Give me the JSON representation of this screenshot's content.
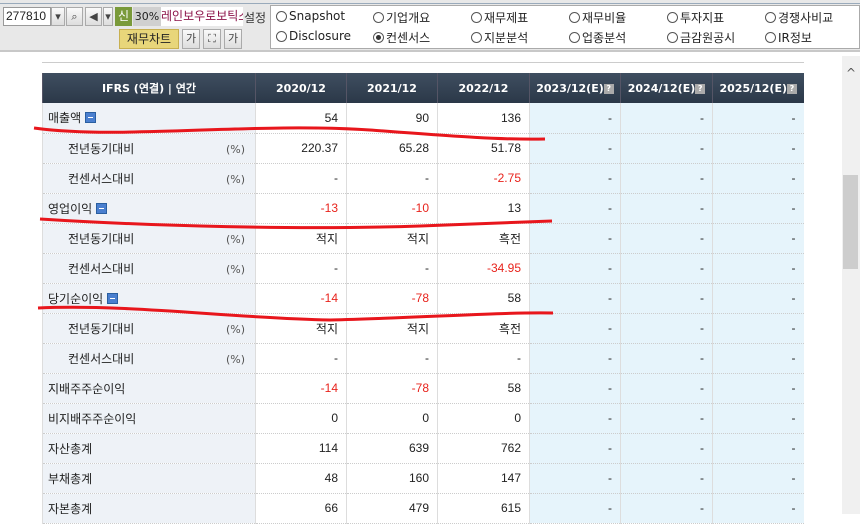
{
  "toolbar": {
    "stock_code": "277810",
    "badge": "신",
    "percent": "30%",
    "company": "레인보우로보틱스",
    "settings_label": "설정",
    "chart_button": "재무차트",
    "font_down": "가",
    "font_up": "가"
  },
  "radios": [
    {
      "label": "Snapshot",
      "checked": false
    },
    {
      "label": "기업개요",
      "checked": false
    },
    {
      "label": "재무제표",
      "checked": false
    },
    {
      "label": "재무비율",
      "checked": false
    },
    {
      "label": "투자지표",
      "checked": false
    },
    {
      "label": "경쟁사비교",
      "checked": false
    },
    {
      "label": "Disclosure",
      "checked": false
    },
    {
      "label": "컨센서스",
      "checked": true
    },
    {
      "label": "지분분석",
      "checked": false
    },
    {
      "label": "업종분석",
      "checked": false
    },
    {
      "label": "금감원공시",
      "checked": false
    },
    {
      "label": "IR정보",
      "checked": false
    }
  ],
  "table": {
    "header": "IFRS (연결) | 연간",
    "columns": [
      "2020/12",
      "2021/12",
      "2022/12",
      "2023/12(E)",
      "2024/12(E)",
      "2025/12(E)"
    ],
    "estimate_help_icon": "?",
    "rows": [
      {
        "label": "매출액",
        "collapsible": true,
        "values": [
          "54",
          "90",
          "136",
          "-",
          "-",
          "-"
        ]
      },
      {
        "label": "전년동기대비",
        "unit": "(%)",
        "sub": true,
        "values": [
          "220.37",
          "65.28",
          "51.78",
          "-",
          "-",
          "-"
        ]
      },
      {
        "label": "컨센서스대비",
        "unit": "(%)",
        "sub": true,
        "values": [
          "-",
          "-",
          "-2.75",
          "-",
          "-",
          "-"
        ]
      },
      {
        "label": "영업이익",
        "collapsible": true,
        "values": [
          "-13",
          "-10",
          "13",
          "-",
          "-",
          "-"
        ]
      },
      {
        "label": "전년동기대비",
        "unit": "(%)",
        "sub": true,
        "values": [
          "적지",
          "적지",
          "흑전",
          "-",
          "-",
          "-"
        ]
      },
      {
        "label": "컨센서스대비",
        "unit": "(%)",
        "sub": true,
        "values": [
          "-",
          "-",
          "-34.95",
          "-",
          "-",
          "-"
        ]
      },
      {
        "label": "당기순이익",
        "collapsible": true,
        "values": [
          "-14",
          "-78",
          "58",
          "-",
          "-",
          "-"
        ]
      },
      {
        "label": "전년동기대비",
        "unit": "(%)",
        "sub": true,
        "values": [
          "적지",
          "적지",
          "흑전",
          "-",
          "-",
          "-"
        ]
      },
      {
        "label": "컨센서스대비",
        "unit": "(%)",
        "sub": true,
        "values": [
          "-",
          "-",
          "-",
          "-",
          "-",
          "-"
        ]
      },
      {
        "label": "지배주주순이익",
        "values": [
          "-14",
          "-78",
          "58",
          "-",
          "-",
          "-"
        ]
      },
      {
        "label": "비지배주주순이익",
        "values": [
          "0",
          "0",
          "0",
          "-",
          "-",
          "-"
        ]
      },
      {
        "label": "자산총계",
        "values": [
          "114",
          "639",
          "762",
          "-",
          "-",
          "-"
        ]
      },
      {
        "label": "부채총계",
        "values": [
          "48",
          "160",
          "147",
          "-",
          "-",
          "-"
        ]
      },
      {
        "label": "자본총계",
        "values": [
          "66",
          "479",
          "615",
          "-",
          "-",
          "-"
        ]
      }
    ]
  },
  "colors": {
    "negative": "#e8231c",
    "annotation": "#e8161c",
    "header_bg": "#2f3d4e",
    "estimate_bg": "#e6f4fb"
  }
}
